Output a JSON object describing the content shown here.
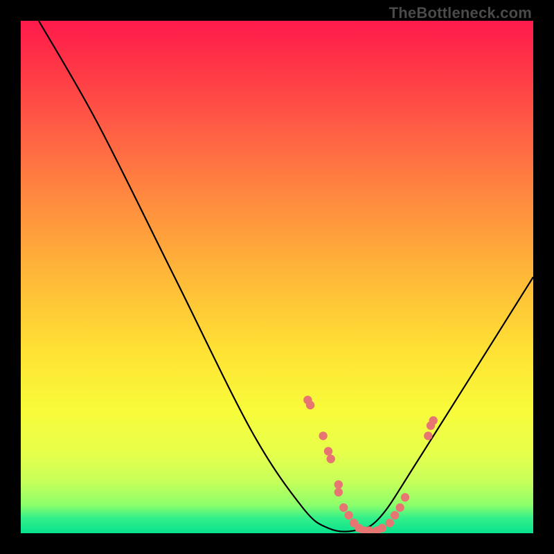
{
  "watermark": "TheBottleneck.com",
  "colors": {
    "gradient_top": "#ff1a4d",
    "gradient_bottom": "#08e28d",
    "curve": "#000000",
    "dot": "#e77672"
  },
  "chart_data": {
    "type": "line",
    "title": "",
    "xlabel": "",
    "ylabel": "",
    "xlim": [
      0,
      100
    ],
    "ylim": [
      0,
      100
    ],
    "series": [
      {
        "name": "curve",
        "x": [
          3.5,
          15,
          30,
          45,
          55,
          60,
          65,
          70,
          78,
          100
        ],
        "values": [
          100,
          80,
          50,
          20,
          5,
          1,
          0.5,
          3,
          15,
          50
        ]
      }
    ],
    "dots": [
      {
        "x": 56,
        "y": 26
      },
      {
        "x": 56.5,
        "y": 25
      },
      {
        "x": 59,
        "y": 19
      },
      {
        "x": 60,
        "y": 16
      },
      {
        "x": 60.5,
        "y": 14.5
      },
      {
        "x": 62,
        "y": 9.5
      },
      {
        "x": 62,
        "y": 8
      },
      {
        "x": 63,
        "y": 5
      },
      {
        "x": 64,
        "y": 3.5
      },
      {
        "x": 65,
        "y": 2
      },
      {
        "x": 66,
        "y": 1
      },
      {
        "x": 67,
        "y": 0.5
      },
      {
        "x": 68,
        "y": 0.5
      },
      {
        "x": 69.5,
        "y": 0.5
      },
      {
        "x": 70.5,
        "y": 1
      },
      {
        "x": 72,
        "y": 2
      },
      {
        "x": 73,
        "y": 3.5
      },
      {
        "x": 74,
        "y": 5
      },
      {
        "x": 75,
        "y": 7
      },
      {
        "x": 79.5,
        "y": 19
      },
      {
        "x": 80,
        "y": 21
      },
      {
        "x": 80.5,
        "y": 22
      }
    ]
  }
}
